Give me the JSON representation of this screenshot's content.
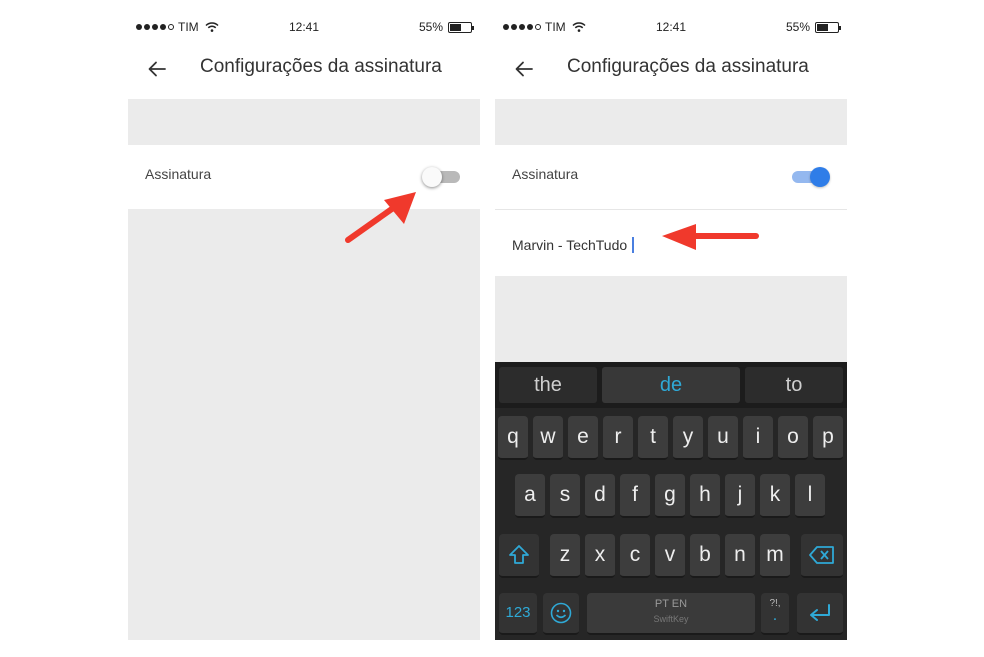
{
  "status_bar": {
    "carrier": "TIM",
    "time": "12:41",
    "battery": "55%",
    "battery_level": 0.55
  },
  "app_bar": {
    "back_icon": "arrow-left-icon",
    "title": "Configurações da assinatura"
  },
  "left_screen": {
    "signature_label": "Assinatura",
    "signature_enabled": false
  },
  "right_screen": {
    "signature_label": "Assinatura",
    "signature_enabled": true,
    "signature_value": "Marvin - TechTudo"
  },
  "annotations": {
    "arrow_color": "#f0392c"
  },
  "keyboard": {
    "suggestions": [
      "the",
      "de",
      "to"
    ],
    "active_suggestion": "de",
    "row1": [
      "q",
      "w",
      "e",
      "r",
      "t",
      "y",
      "u",
      "i",
      "o",
      "p"
    ],
    "row2": [
      "a",
      "s",
      "d",
      "f",
      "g",
      "h",
      "j",
      "k",
      "l"
    ],
    "row3": [
      "z",
      "x",
      "c",
      "v",
      "b",
      "n",
      "m"
    ],
    "shift_icon": "shift-arrow-icon",
    "backspace_icon": "backspace-icon",
    "numbers_key": "123",
    "emoji_icon": "emoji-smile-icon",
    "space_language": "PT EN",
    "space_brand": "SwiftKey",
    "punct_top": "?!,",
    "punct_main": ".",
    "enter_icon": "return-arrow-icon",
    "accent_color": "#2fa9d6"
  }
}
